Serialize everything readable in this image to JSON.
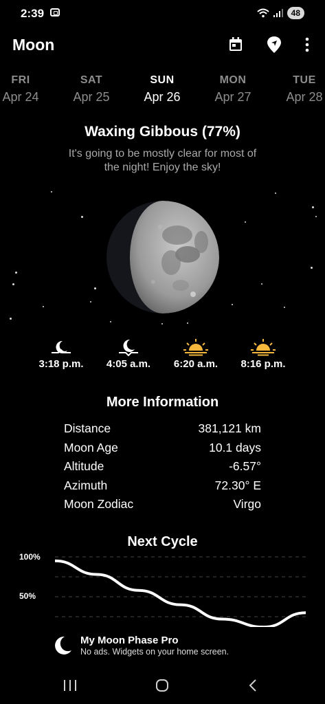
{
  "status_bar": {
    "time": "2:39",
    "battery": "48"
  },
  "app_bar": {
    "title": "Moon",
    "icons": [
      "calendar-icon",
      "location-pin-icon",
      "more-vert-icon"
    ]
  },
  "days": [
    {
      "dow": "FRI",
      "date": "Apr 24"
    },
    {
      "dow": "SAT",
      "date": "Apr 25"
    },
    {
      "dow": "SUN",
      "date": "Apr 26"
    },
    {
      "dow": "MON",
      "date": "Apr 27"
    },
    {
      "dow": "TUE",
      "date": "Apr 28"
    }
  ],
  "selected_day": "SUN",
  "phase": {
    "title": "Waxing Gibbous (77%)",
    "description": "It's going to be mostly clear for most of the night! Enjoy the sky!",
    "illumination": 0.77
  },
  "events": [
    {
      "icon": "moonrise-icon",
      "time": "3:18 p.m."
    },
    {
      "icon": "moonset-icon",
      "time": "4:05 a.m."
    },
    {
      "icon": "sunrise-icon",
      "time": "6:20 a.m."
    },
    {
      "icon": "sunset-icon",
      "time": "8:16 p.m."
    }
  ],
  "more_info": {
    "title": "More Information",
    "rows": [
      {
        "label": "Distance",
        "value": "381,121 km"
      },
      {
        "label": "Moon Age",
        "value": "10.1 days"
      },
      {
        "label": "Altitude",
        "value": "-6.57°"
      },
      {
        "label": "Azimuth",
        "value": "72.30° E"
      },
      {
        "label": "Moon Zodiac",
        "value": "Virgo"
      }
    ]
  },
  "next_cycle": {
    "title": "Next Cycle",
    "y_labels": [
      "100%",
      "50%"
    ]
  },
  "chart_data": {
    "type": "line",
    "title": "Next Cycle",
    "ylim": [
      0,
      100
    ],
    "yticks": [
      "100%",
      "50%"
    ],
    "grid": true,
    "series": [
      {
        "x": [
          0,
          1,
          2,
          3,
          4,
          5,
          6
        ],
        "values": [
          95,
          78,
          58,
          40,
          22,
          12,
          30
        ]
      }
    ]
  },
  "promo": {
    "title": "My Moon Phase Pro",
    "subtitle": "No ads. Widgets on your home screen."
  },
  "colors": {
    "background": "#000000",
    "accent_sun": "#f5b83d",
    "inactive_text": "#8d8d8d"
  }
}
